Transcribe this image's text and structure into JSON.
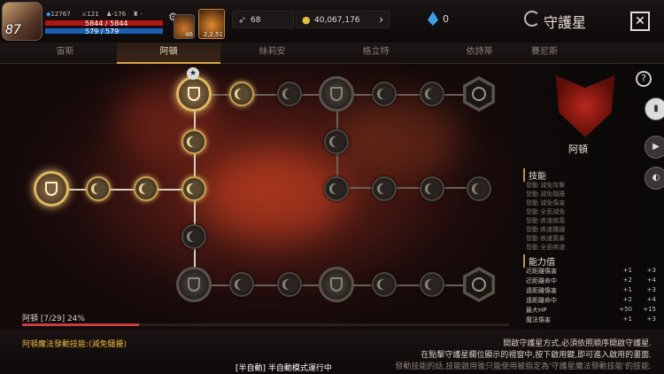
{
  "player": {
    "level": "87",
    "stat_a": "12767",
    "stat_b": "121",
    "stat_c": "-176",
    "stat_d": "-",
    "hp": "5844 / 5844",
    "mp": "579 / 579"
  },
  "quickslots": [
    {
      "count": "46"
    },
    {
      "count": "2,2,51"
    }
  ],
  "currency": {
    "feather": "68",
    "gold": "40,067,176",
    "gem": "0"
  },
  "window": {
    "title": "守護星",
    "close": "✕"
  },
  "tabs": [
    "宙斯",
    "阿頓",
    "絲莉安",
    "格立特",
    "依詩蒂",
    "賽尼斯"
  ],
  "active_tab": 1,
  "panel": {
    "guardian_name": "阿頓",
    "skills_header": "技能",
    "skills": [
      "發動 減免攻擊",
      "發動 減免騷擾",
      "發動 減免傷害",
      "發動 全面減免",
      "發動 疾速疾風",
      "發動 疾速難纏",
      "發動 疾速風暴",
      "發動 全面疾速"
    ],
    "stats_header": "能力值",
    "stats": [
      {
        "name": "近距離傷害",
        "a": "+1",
        "b": "+3"
      },
      {
        "name": "近距離命中",
        "a": "+2",
        "b": "+4"
      },
      {
        "name": "遠距離傷害",
        "a": "+1",
        "b": "+3"
      },
      {
        "name": "遠距離命中",
        "a": "+2",
        "b": "+4"
      },
      {
        "name": "最大HP",
        "a": "+50",
        "b": "+15"
      },
      {
        "name": "魔法傷害",
        "a": "+1",
        "b": "+3"
      }
    ]
  },
  "progress": {
    "label": "阿頓 [7/29] 24%",
    "fraction": 0.24
  },
  "bottom": {
    "skill_text": "阿頓魔法發動技能:(減免騷擾)",
    "info": [
      "開啟守護星方式,必須依照順序開啟守護星.",
      "在點擊守護星欄位顯示的視窗中,按下啟用鍵,即可進入啟用的畫面.",
      "發動技能的話,技能啟用後只能使用被指定為'守護星魔法發動技能'的技能."
    ],
    "auto_mode": "[半自動] 半自動模式運行中"
  }
}
